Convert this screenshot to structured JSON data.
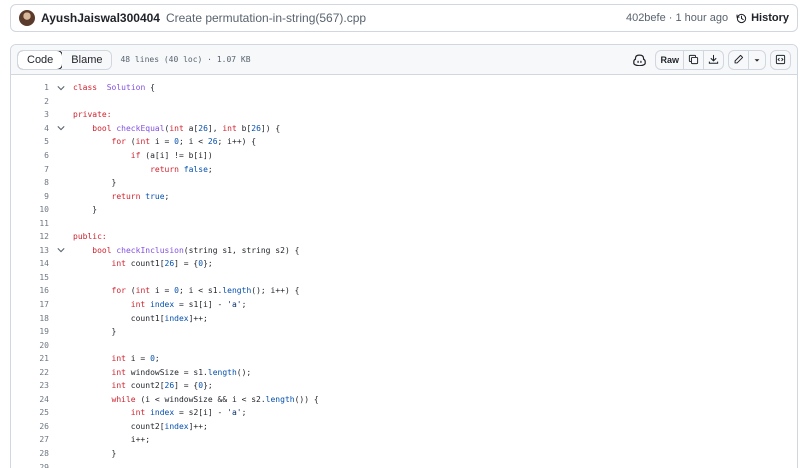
{
  "commit": {
    "author": "AyushJaiswal300404",
    "message": "Create permutation-in-string(567).cpp",
    "meta": "402befe · 1 hour ago",
    "history_label": "History"
  },
  "file": {
    "tabs": [
      "Code",
      "Blame"
    ],
    "info": "48 lines (40 loc) · 1.07 KB",
    "raw_label": "Raw"
  },
  "icons": {
    "avatar": "user-avatar",
    "history": "history-icon",
    "copilot": "copilot-icon",
    "copy": "copy-icon",
    "download": "download-icon",
    "edit": "pencil-icon",
    "dropdown": "chevron-down-icon",
    "symbols": "symbols-panel-icon",
    "fold": "chevron-down-icon"
  },
  "colors": {
    "keyword": "#cf222e",
    "function": "#8250df",
    "number": "#0550ae",
    "string": "#0a3069",
    "border": "#d0d7de"
  },
  "code": {
    "lines": [
      {
        "n": "1",
        "fold": true,
        "tokens": [
          [
            "kw",
            "class"
          ],
          [
            "",
            "  "
          ],
          [
            "fn",
            "Solution"
          ],
          [
            "",
            " {"
          ]
        ]
      },
      {
        "n": "2",
        "fold": false,
        "tokens": []
      },
      {
        "n": "3",
        "fold": false,
        "tokens": [
          [
            "kw",
            "private:"
          ]
        ]
      },
      {
        "n": "4",
        "fold": true,
        "tokens": [
          [
            "",
            "    "
          ],
          [
            "kw",
            "bool"
          ],
          [
            "",
            " "
          ],
          [
            "fn",
            "checkEqual"
          ],
          [
            "",
            "("
          ],
          [
            "kw",
            "int"
          ],
          [
            "",
            " a["
          ],
          [
            "num",
            "26"
          ],
          [
            "",
            "], "
          ],
          [
            "kw",
            "int"
          ],
          [
            "",
            " b["
          ],
          [
            "num",
            "26"
          ],
          [
            "",
            "]) {"
          ]
        ]
      },
      {
        "n": "5",
        "fold": false,
        "tokens": [
          [
            "",
            "        "
          ],
          [
            "kw",
            "for"
          ],
          [
            "",
            " ("
          ],
          [
            "kw",
            "int"
          ],
          [
            "",
            " i = "
          ],
          [
            "num",
            "0"
          ],
          [
            "",
            "; i < "
          ],
          [
            "num",
            "26"
          ],
          [
            "",
            "; i++) {"
          ]
        ]
      },
      {
        "n": "6",
        "fold": false,
        "tokens": [
          [
            "",
            "            "
          ],
          [
            "kw",
            "if"
          ],
          [
            "",
            " (a[i] != b[i])"
          ]
        ]
      },
      {
        "n": "7",
        "fold": false,
        "tokens": [
          [
            "",
            "                "
          ],
          [
            "kw",
            "return"
          ],
          [
            "",
            " "
          ],
          [
            "num",
            "false"
          ],
          [
            "",
            ";"
          ]
        ]
      },
      {
        "n": "8",
        "fold": false,
        "tokens": [
          [
            "",
            "        }"
          ]
        ]
      },
      {
        "n": "9",
        "fold": false,
        "tokens": [
          [
            "",
            "        "
          ],
          [
            "kw",
            "return"
          ],
          [
            "",
            " "
          ],
          [
            "num",
            "true"
          ],
          [
            "",
            ";"
          ]
        ]
      },
      {
        "n": "10",
        "fold": false,
        "tokens": [
          [
            "",
            "    }"
          ]
        ]
      },
      {
        "n": "11",
        "fold": false,
        "tokens": []
      },
      {
        "n": "12",
        "fold": false,
        "tokens": [
          [
            "kw",
            "public:"
          ]
        ]
      },
      {
        "n": "13",
        "fold": true,
        "tokens": [
          [
            "",
            "    "
          ],
          [
            "kw",
            "bool"
          ],
          [
            "",
            " "
          ],
          [
            "fn",
            "checkInclusion"
          ],
          [
            "",
            "(string s1, string s2) {"
          ]
        ]
      },
      {
        "n": "14",
        "fold": false,
        "tokens": [
          [
            "",
            "        "
          ],
          [
            "kw",
            "int"
          ],
          [
            "",
            " count1["
          ],
          [
            "num",
            "26"
          ],
          [
            "",
            "] = {"
          ],
          [
            "num",
            "0"
          ],
          [
            "",
            "};"
          ]
        ]
      },
      {
        "n": "15",
        "fold": false,
        "tokens": []
      },
      {
        "n": "16",
        "fold": false,
        "tokens": [
          [
            "",
            "        "
          ],
          [
            "kw",
            "for"
          ],
          [
            "",
            " ("
          ],
          [
            "kw",
            "int"
          ],
          [
            "",
            " i = "
          ],
          [
            "num",
            "0"
          ],
          [
            "",
            "; i < s1."
          ],
          [
            "pr",
            "length"
          ],
          [
            "",
            "(); i++) {"
          ]
        ]
      },
      {
        "n": "17",
        "fold": false,
        "tokens": [
          [
            "",
            "            "
          ],
          [
            "kw",
            "int"
          ],
          [
            "",
            " "
          ],
          [
            "pr",
            "index"
          ],
          [
            "",
            " = s1[i] - "
          ],
          [
            "str",
            "'a'"
          ],
          [
            "",
            ";"
          ]
        ]
      },
      {
        "n": "18",
        "fold": false,
        "tokens": [
          [
            "",
            "            count1["
          ],
          [
            "pr",
            "index"
          ],
          [
            "",
            "]++;"
          ]
        ]
      },
      {
        "n": "19",
        "fold": false,
        "tokens": [
          [
            "",
            "        }"
          ]
        ]
      },
      {
        "n": "20",
        "fold": false,
        "tokens": []
      },
      {
        "n": "21",
        "fold": false,
        "tokens": [
          [
            "",
            "        "
          ],
          [
            "kw",
            "int"
          ],
          [
            "",
            " i = "
          ],
          [
            "num",
            "0"
          ],
          [
            "",
            ";"
          ]
        ]
      },
      {
        "n": "22",
        "fold": false,
        "tokens": [
          [
            "",
            "        "
          ],
          [
            "kw",
            "int"
          ],
          [
            "",
            " windowSize = s1."
          ],
          [
            "pr",
            "length"
          ],
          [
            "",
            "();"
          ]
        ]
      },
      {
        "n": "23",
        "fold": false,
        "tokens": [
          [
            "",
            "        "
          ],
          [
            "kw",
            "int"
          ],
          [
            "",
            " count2["
          ],
          [
            "num",
            "26"
          ],
          [
            "",
            "] = {"
          ],
          [
            "num",
            "0"
          ],
          [
            "",
            "};"
          ]
        ]
      },
      {
        "n": "24",
        "fold": false,
        "tokens": [
          [
            "",
            "        "
          ],
          [
            "kw",
            "while"
          ],
          [
            "",
            " (i < windowSize && i < s2."
          ],
          [
            "pr",
            "length"
          ],
          [
            "",
            "()) {"
          ]
        ]
      },
      {
        "n": "25",
        "fold": false,
        "tokens": [
          [
            "",
            "            "
          ],
          [
            "kw",
            "int"
          ],
          [
            "",
            " "
          ],
          [
            "pr",
            "index"
          ],
          [
            "",
            " = s2[i] - "
          ],
          [
            "str",
            "'a'"
          ],
          [
            "",
            ";"
          ]
        ]
      },
      {
        "n": "26",
        "fold": false,
        "tokens": [
          [
            "",
            "            count2["
          ],
          [
            "pr",
            "index"
          ],
          [
            "",
            "]++;"
          ]
        ]
      },
      {
        "n": "27",
        "fold": false,
        "tokens": [
          [
            "",
            "            i++;"
          ]
        ]
      },
      {
        "n": "28",
        "fold": false,
        "tokens": [
          [
            "",
            "        }"
          ]
        ]
      },
      {
        "n": "29",
        "fold": false,
        "tokens": []
      }
    ]
  }
}
